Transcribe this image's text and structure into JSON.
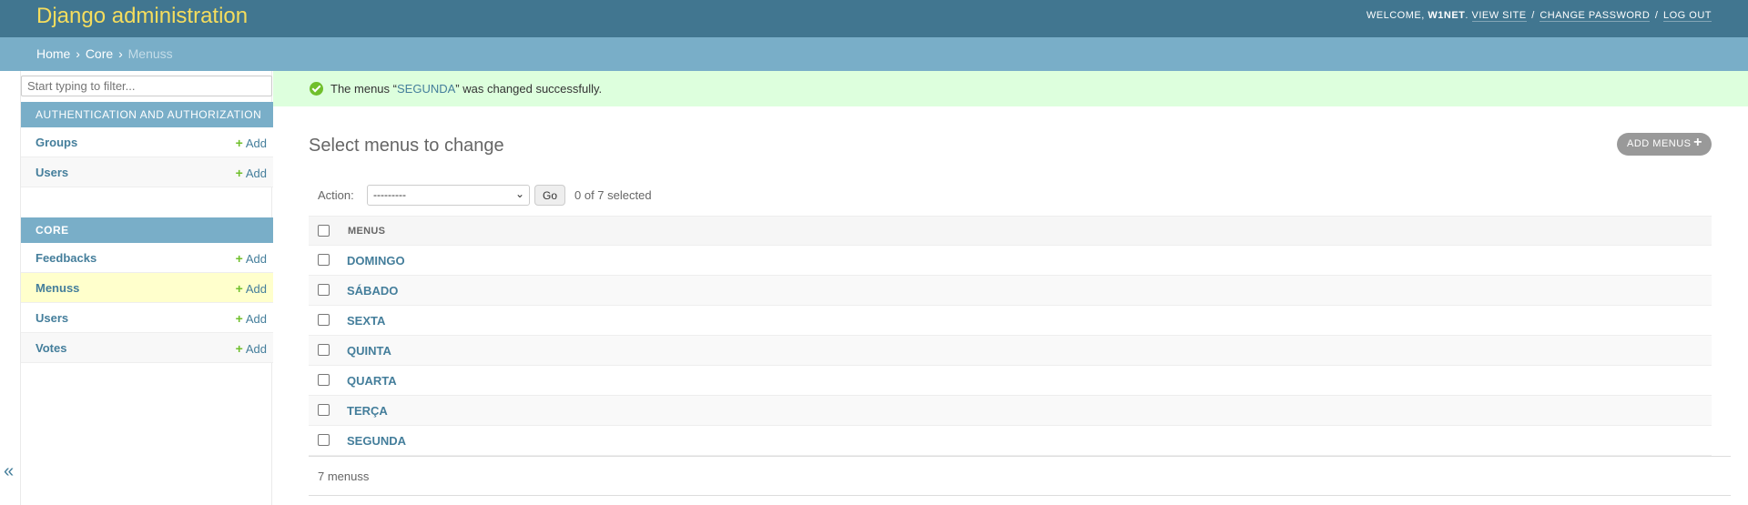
{
  "header": {
    "branding": "Django administration",
    "welcome": "Welcome,",
    "username": "W1NET",
    "view_site": "View site",
    "change_password": "Change password",
    "log_out": "Log out",
    "separator": "/"
  },
  "breadcrumbs": {
    "home": "Home",
    "app": "Core",
    "current": "Menuss",
    "arrow": "›"
  },
  "sidebar": {
    "filter_placeholder": "Start typing to filter...",
    "modules": [
      {
        "caption": "Authentication and Authorization",
        "items": [
          {
            "label": "Groups",
            "add": "Add"
          },
          {
            "label": "Users",
            "add": "Add"
          }
        ]
      },
      {
        "caption": "Core",
        "items": [
          {
            "label": "Feedbacks",
            "add": "Add"
          },
          {
            "label": "Menuss",
            "add": "Add"
          },
          {
            "label": "Users",
            "add": "Add"
          },
          {
            "label": "Votes",
            "add": "Add"
          }
        ]
      }
    ],
    "toggle": "«"
  },
  "messages": {
    "prefix": "The menus “",
    "link": "SEGUNDA",
    "suffix": "” was changed successfully."
  },
  "content": {
    "title": "Select menus to change",
    "add_button": "Add menus",
    "add_plus": "+"
  },
  "actions": {
    "label": "Action:",
    "selected_option": "---------",
    "go": "Go",
    "counter": "0 of 7 selected"
  },
  "table": {
    "column": "MENUS",
    "rows": [
      "DOMINGO",
      "SÁBADO",
      "SEXTA",
      "QUINTA",
      "QUARTA",
      "TERÇA",
      "SEGUNDA"
    ]
  },
  "paginator": {
    "text": "7 menuss"
  },
  "colors": {
    "header": "#417690",
    "breadcrumbs": "#79aec8",
    "link": "#447e9b",
    "success_bg": "#ddffdd",
    "add_plus": "#70bf2b",
    "current_row": "#ffffcc"
  },
  "icons": {
    "success": "checkmark-circle-icon",
    "add": "plus-icon",
    "toggle": "double-chevron-left-icon",
    "select": "chevron-down-icon"
  }
}
